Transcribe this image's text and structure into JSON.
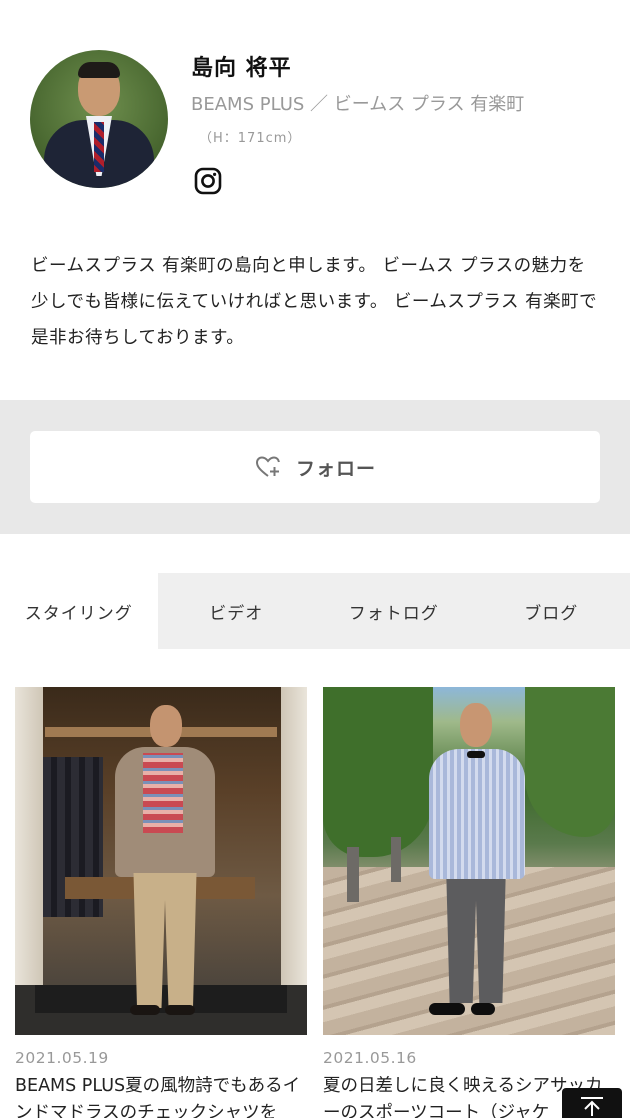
{
  "profile": {
    "name": "島向 将平",
    "shop": "BEAMS PLUS ／ ビームス プラス 有楽町",
    "height": "（H：171cm）",
    "avatar_icon": "staff-portrait",
    "social_icon": "instagram-icon",
    "intro": "ビームスプラス 有楽町の島向と申します。 ビームス プラスの魅力を少しでも皆様に伝えていければと思います。 ビームスプラス 有楽町で是非お待ちしております。"
  },
  "follow": {
    "label": "フォロー",
    "icon": "heart-plus-icon"
  },
  "tabs": [
    {
      "label": "スタイリング",
      "active": true
    },
    {
      "label": "ビデオ",
      "active": false
    },
    {
      "label": "フォトログ",
      "active": false
    },
    {
      "label": "ブログ",
      "active": false
    }
  ],
  "posts": [
    {
      "date": "2021.05.19",
      "title": "BEAMS PLUS夏の風物詩でもあるインドマドラスのチェックシャツを"
    },
    {
      "date": "2021.05.16",
      "title": "夏の日差しに良く映えるシアサッカーのスポーツコート（ジャケ"
    }
  ],
  "scroll_top": {
    "icon": "arrow-up-icon"
  },
  "colors": {
    "muted": "#999999",
    "band": "#e8e8e8",
    "tab_bg": "#efefef"
  }
}
